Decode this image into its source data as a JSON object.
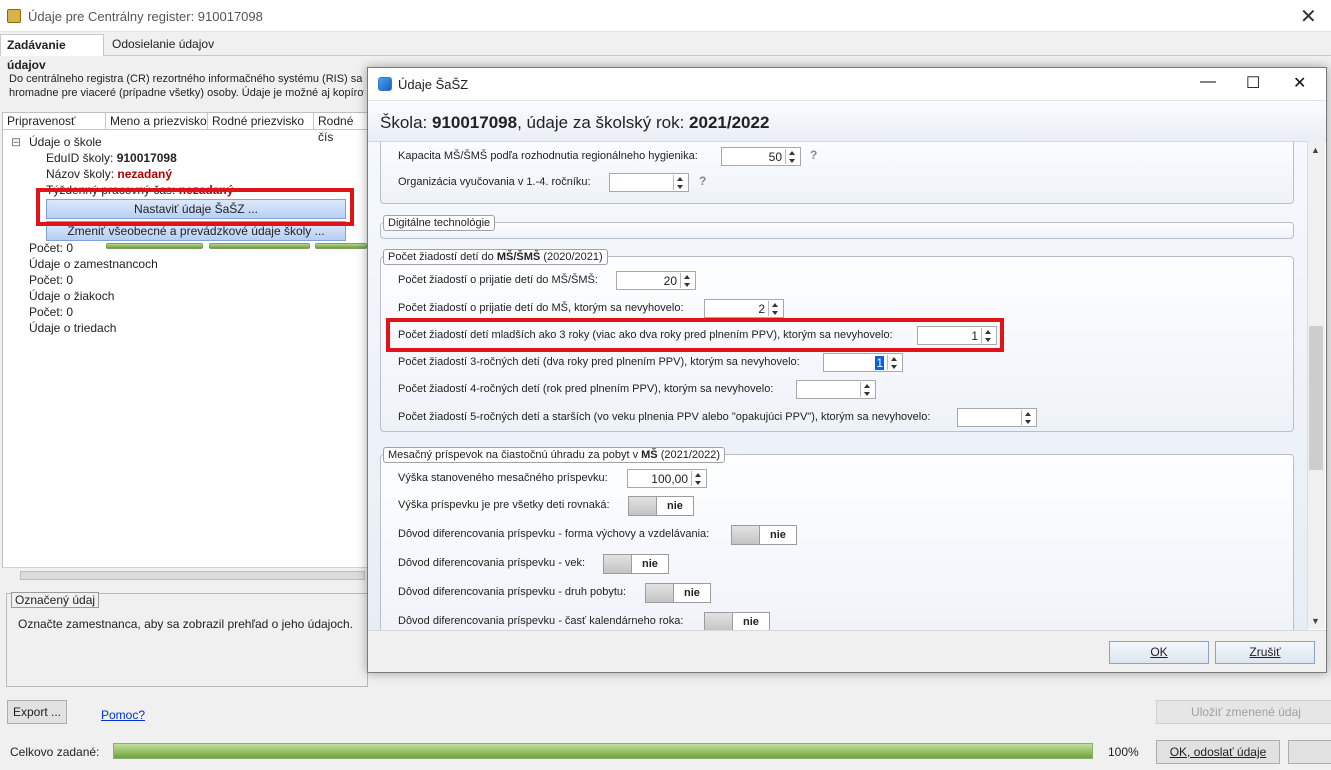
{
  "window": {
    "title": "Údaje pre Centrálny register: 910017098",
    "close": "✕"
  },
  "tabs": [
    {
      "label": "Zadávanie údajov"
    },
    {
      "label": "Odosielanie údajov"
    }
  ],
  "description": {
    "line1": "Do centrálneho registra (CR) rezortného informačného systému (RIS) sa o",
    "line2": "hromadne pre viaceré (prípadne všetky) osoby. Údaje je možné aj kopírov"
  },
  "table": {
    "columns": [
      "Pripravenosť",
      "Meno a priezvisko",
      "Rodné priezvisko",
      "Rodné čís"
    ],
    "tree": {
      "school": "Údaje o škole",
      "eduid_label": "EduID školy:",
      "eduid_value": "910017098",
      "name_label": "Názov školy:",
      "name_value": "nezadaný",
      "weekly_label": "Týždenný pracovný čas:",
      "weekly_value": "nezadaný",
      "btn_sasz": "Nastaviť údaje ŠaŠZ ...",
      "btn_general": "Zmeniť všeobecné a prevádzkové údaje školy ...",
      "count0a": "Počet: 0",
      "employees": "Údaje o zamestnancoch",
      "count0b": "Počet: 0",
      "pupils": "Údaje o žiakoch",
      "count0c": "Počet: 0",
      "classes": "Údaje o triedach"
    }
  },
  "marked": {
    "legend": "Označený údaj",
    "text": "Označte zamestnanca, aby sa zobrazil prehľad o jeho údajoch."
  },
  "bottom": {
    "export": "Export ...",
    "help": "Pomoc?",
    "save": "Uložiť zmenené údaj",
    "total_label": "Celkovo zadané:",
    "total_pct": "100%",
    "total_fraction": 1.0,
    "ok_send": "OK, odoslať údaje"
  },
  "dialog": {
    "title": "Údaje ŠaŠZ",
    "controls": {
      "minimize": "—",
      "maximize": "☐",
      "close": "✕"
    },
    "header": {
      "prefix": "Škola: ",
      "school": "910017098",
      "mid": ", údaje za školský rok: ",
      "year": "2021/2022"
    },
    "top_rows": [
      {
        "label": "Kapacita MŠ/ŠMŠ podľa rozhodnutia regionálneho hygienika:",
        "value": "50",
        "help": "?"
      },
      {
        "label": "Organizácia vyučovania v 1.-4. ročníku:",
        "value": "",
        "help": "?"
      }
    ],
    "digital": {
      "legend": "Digitálne technológie"
    },
    "requests": {
      "legend_pre": "Počet žiadostí detí do ",
      "legend_bold": "MŠ/ŠMŠ",
      "legend_post": " (2020/2021)",
      "rows": [
        {
          "label": "Počet žiadostí o prijatie detí do MŠ/ŠMŠ:",
          "value": "20"
        },
        {
          "label": "Počet žiadostí o prijatie detí do MŠ, ktorým sa nevyhovelo:",
          "value": "2"
        },
        {
          "label": "Počet žiadostí detí mladších ako 3 roky (viac ako dva roky pred plnením PPV), ktorým sa nevyhovelo:",
          "value": "1"
        },
        {
          "label": "Počet žiadostí 3-ročných detí (dva roky pred plnením PPV), ktorým sa nevyhovelo:",
          "value": "1"
        },
        {
          "label": "Počet žiadostí 4-ročných detí (rok pred plnením PPV), ktorým sa nevyhovelo:",
          "value": ""
        },
        {
          "label": "Počet žiadostí 5-ročných detí a starších (vo veku plnenia PPV alebo \"opakujúci PPV\"), ktorým sa nevyhovelo:",
          "value": ""
        }
      ]
    },
    "fee": {
      "legend_pre": "Mesačný príspevok na čiastočnú úhradu za pobyt v ",
      "legend_bold": "MŠ",
      "legend_post": " (2021/2022)",
      "amount_label": "Výška stanoveného mesačného príspevku:",
      "amount_value": "100,00",
      "toggles": [
        {
          "label": "Výška príspevku je pre všetky deti rovnaká:",
          "value": "nie"
        },
        {
          "label": "Dôvod diferencovania príspevku - forma výchovy a vzdelávania:",
          "value": "nie"
        },
        {
          "label": "Dôvod diferencovania príspevku - vek:",
          "value": "nie"
        },
        {
          "label": "Dôvod diferencovania príspevku - druh pobytu:",
          "value": "nie"
        },
        {
          "label": "Dôvod diferencovania príspevku - časť kalendárneho roka:",
          "value": "nie"
        }
      ]
    },
    "ok": "OK",
    "cancel": "Zrušiť"
  }
}
